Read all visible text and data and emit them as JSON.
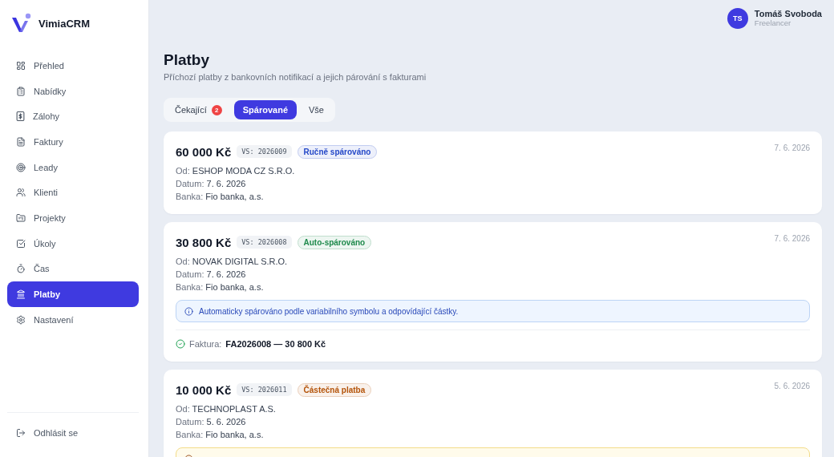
{
  "sidebar": {
    "logo": "VimiaCRM",
    "items": [
      {
        "label": "Přehled",
        "selected": false
      },
      {
        "label": "Nabídky",
        "selected": false
      },
      {
        "label": "Zálohy",
        "selected": false
      },
      {
        "label": "Faktury",
        "selected": false
      },
      {
        "label": "Leady",
        "selected": false
      },
      {
        "label": "Klienti",
        "selected": false
      },
      {
        "label": "Projekty",
        "selected": false
      },
      {
        "label": "Úkoly",
        "selected": false
      },
      {
        "label": "Čas",
        "selected": false
      },
      {
        "label": "Platby",
        "selected": true
      },
      {
        "label": "Nastavení",
        "selected": false
      }
    ],
    "logout": "Odhlásit se"
  },
  "user": {
    "initials": "TS",
    "name": "Tomáš Svoboda",
    "role": "Freelancer"
  },
  "page": {
    "title": "Platby",
    "subtitle": "Příchozí platby z bankovních notifikací a jejich párování s fakturami"
  },
  "tabs": [
    {
      "label": "Čekající",
      "badge": "2",
      "selected": false
    },
    {
      "label": "Spárované",
      "selected": true
    },
    {
      "label": "Vše",
      "selected": false
    }
  ],
  "payments": [
    {
      "amount": "60 000 Kč",
      "vs": "VS: 2026009",
      "status": {
        "label": "Ručně spárováno",
        "color": "#2448c8"
      },
      "date": "7. 6. 2026",
      "fields": [
        {
          "label": "Od:",
          "value": "ESHOP MODA CZ S.R.O."
        },
        {
          "label": "Datum:",
          "value": "7. 6. 2026"
        },
        {
          "label": "Banka:",
          "value": "Fio banka, a.s."
        }
      ]
    },
    {
      "amount": "30 800 Kč",
      "vs": "VS: 2026008",
      "status": {
        "label": "Auto-spárováno",
        "color": "#1f8a4c"
      },
      "date": "7. 6. 2026",
      "fields": [
        {
          "label": "Od:",
          "value": "NOVAK DIGITAL S.R.O."
        },
        {
          "label": "Datum:",
          "value": "7. 6. 2026"
        },
        {
          "label": "Banka:",
          "value": "Fio banka, a.s."
        }
      ],
      "note": {
        "kind": "info",
        "text": "Automaticky spárováno podle variabilního symbolu a odpovídající částky."
      },
      "invoice": {
        "label": "Faktura:",
        "value": "FA2026008 — 30 800 Kč"
      }
    },
    {
      "amount": "10 000 Kč",
      "vs": "VS: 2026011",
      "status": {
        "label": "Částečná platba",
        "color": "#b45309"
      },
      "date": "5. 6. 2026",
      "fields": [
        {
          "label": "Od:",
          "value": "TECHNOPLAST A.S."
        },
        {
          "label": "Datum:",
          "value": "5. 6. 2026"
        },
        {
          "label": "Banka:",
          "value": "Fio banka, a.s."
        }
      ],
      "note": {
        "kind": "warning"
      }
    }
  ]
}
